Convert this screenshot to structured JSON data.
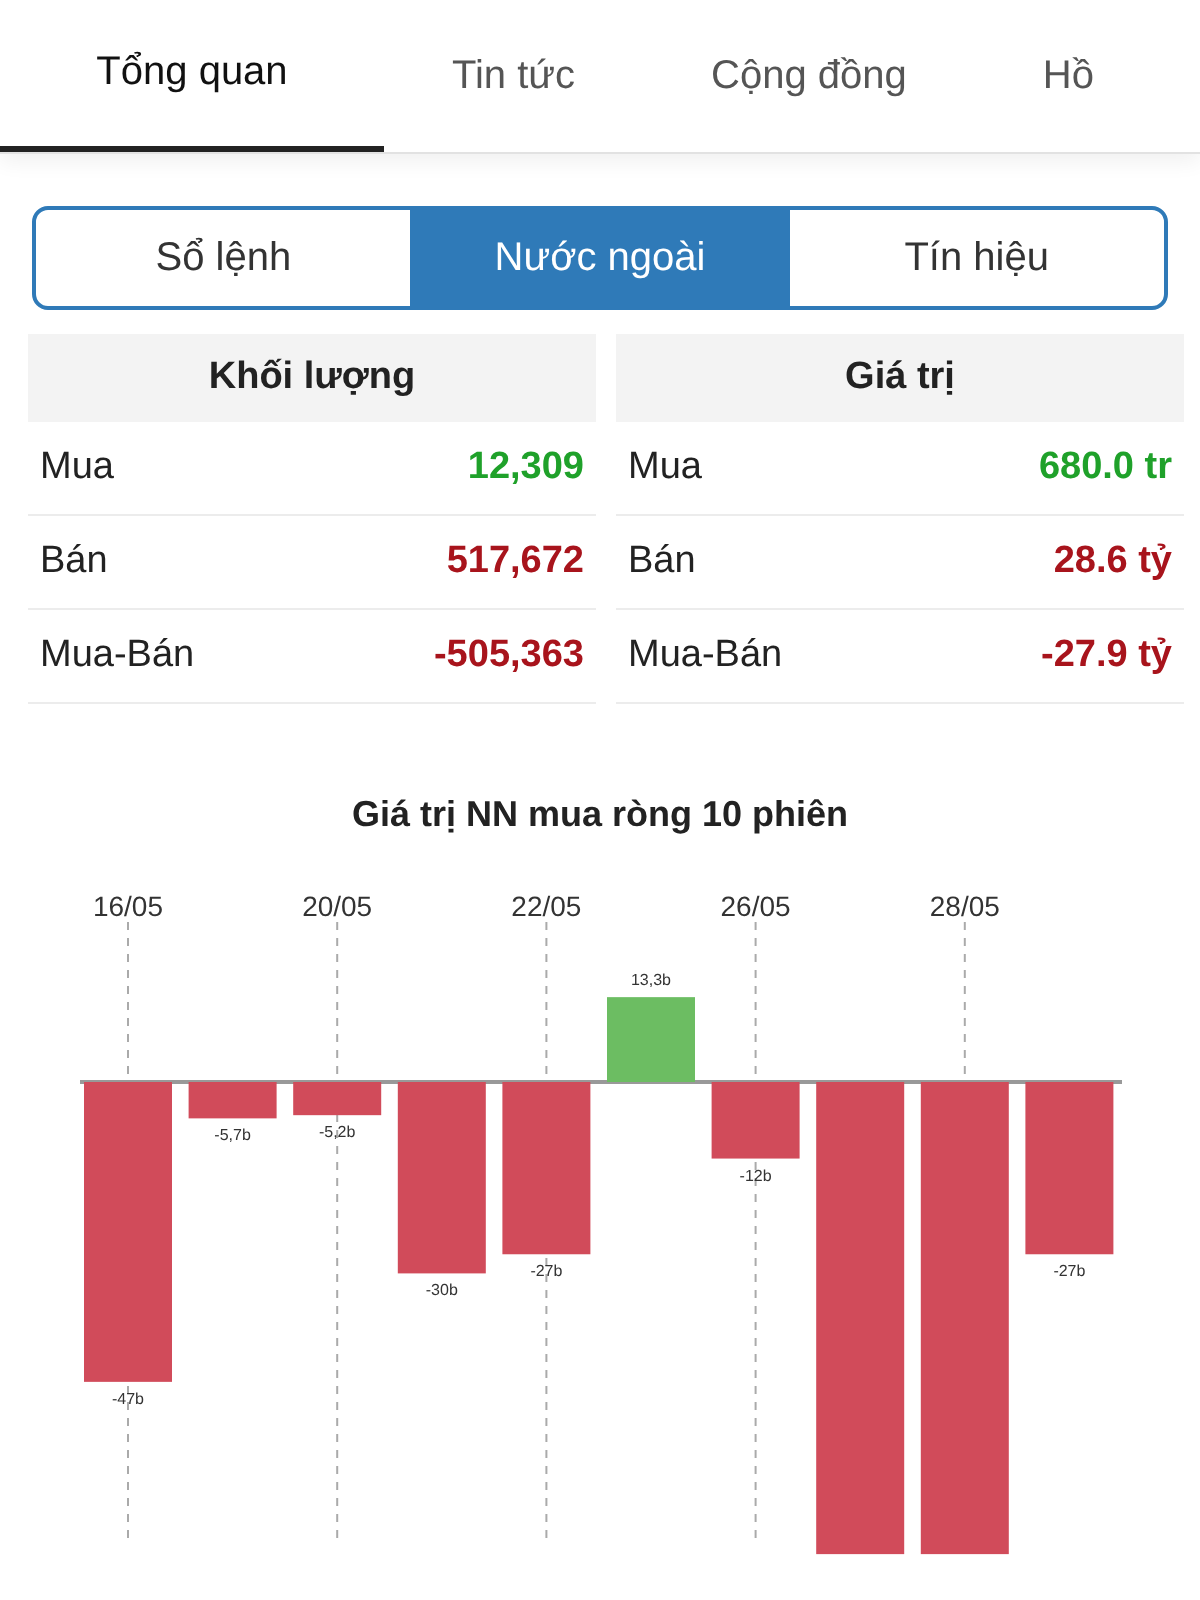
{
  "tabs": [
    {
      "label": "Tổng quan",
      "selected": true
    },
    {
      "label": "Tin tức",
      "selected": false
    },
    {
      "label": "Cộng đồng",
      "selected": false
    },
    {
      "label": "Hồ",
      "selected": false
    }
  ],
  "segments": [
    {
      "label": "Sổ lệnh",
      "selected": false
    },
    {
      "label": "Nước ngoài",
      "selected": true
    },
    {
      "label": "Tín hiệu",
      "selected": false
    }
  ],
  "panels": [
    {
      "heading": "Khối lượng",
      "rows": [
        {
          "label": "Mua",
          "value": "12,309",
          "color": "#1fa12a"
        },
        {
          "label": "Bán",
          "value": "517,672",
          "color": "#a8141c"
        },
        {
          "label": "Mua-Bán",
          "value": "-505,363",
          "color": "#a8141c"
        }
      ]
    },
    {
      "heading": "Giá trị",
      "rows": [
        {
          "label": "Mua",
          "value": "680.0 tr",
          "color": "#1fa12a"
        },
        {
          "label": "Bán",
          "value": "28.6 tỷ",
          "color": "#a8141c"
        },
        {
          "label": "Mua-Bán",
          "value": "-27.9 tỷ",
          "color": "#a8141c"
        }
      ]
    }
  ],
  "chart": {
    "chart_data": {
      "type": "bar",
      "title": "Giá trị NN mua ròng 10 phiên",
      "categories": [
        "16/05",
        null,
        "20/05",
        null,
        "22/05",
        null,
        "26/05",
        null,
        "28/05",
        null
      ],
      "grid": true,
      "values": [
        -47,
        -5.7,
        -5.2,
        -30,
        -27,
        13.3,
        -12,
        -74,
        -74,
        -27
      ],
      "value_labels": [
        "-47b",
        "-5,7b",
        "-5,2b",
        "-30b",
        "-27b",
        "13,3b",
        "-12b",
        null,
        null,
        "-27b"
      ]
    }
  }
}
